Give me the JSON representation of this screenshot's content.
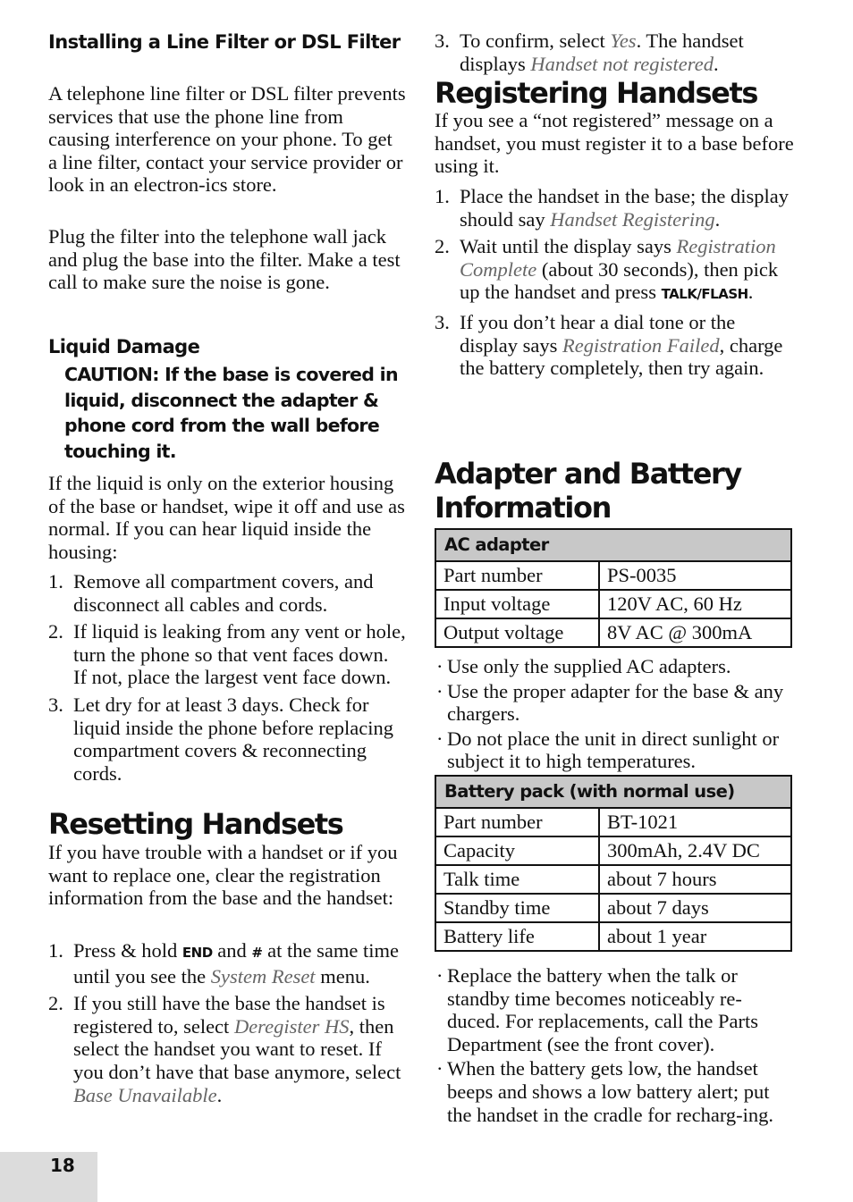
{
  "page_number": "18",
  "left": {
    "line_filter": {
      "heading": "Installing a Line Filter or DSL Filter",
      "para1": "A telephone line filter or DSL filter prevents services that use the phone line from causing interference on your phone. To get a line filter, contact your service provider or look in an electron-ics store.",
      "para2": "Plug the filter into the telephone wall jack and plug the base into the filter. Make a test call to make sure the noise is gone."
    },
    "liquid_damage": {
      "heading": "Liquid Damage",
      "caution": "CAUTION: If the base is covered in liquid, disconnect the adapter & phone cord from the wall before touching it.",
      "intro": "If the liquid is only on the exterior housing of the base or handset, wipe it off and use as normal. If you can hear liquid inside the housing:",
      "steps": [
        {
          "num": "1.",
          "text": "Remove all compartment covers, and disconnect all cables and cords."
        },
        {
          "num": "2.",
          "text": "If liquid is leaking from any vent or hole, turn the phone so that vent faces down. If not, place the largest vent face down."
        },
        {
          "num": "3.",
          "text": "Let dry for at least 3 days. Check for liquid inside the phone before replacing compartment covers & reconnecting cords."
        }
      ]
    },
    "resetting": {
      "heading": "Resetting Handsets",
      "intro": "If you have trouble with a handset or if you want to replace one, clear the registration information from the base and the handset:",
      "step1": {
        "num": "1.",
        "pre": "Press & hold ",
        "key1": "END",
        "mid": " and ",
        "key2": "#",
        "mid2": " at the same time until you see the ",
        "display": "System Reset",
        "post": " menu."
      },
      "step2": {
        "num": "2.",
        "pre": "If you still have the base the handset is registered to, select ",
        "display1": "Deregister HS",
        "mid": ", then select the handset you want to reset. If you don’t have that base anymore, select ",
        "display2": "Base Unavailable",
        "post": "."
      }
    }
  },
  "right": {
    "reset_step3": {
      "num": "3.",
      "pre": "To confirm, select ",
      "display1": "Yes",
      "mid": ". The handset displays ",
      "display2": "Handset not registered",
      "post": "."
    },
    "registering": {
      "heading": "Registering Handsets",
      "intro": "If you see a “not registered” message on a handset, you must register it to a base before using it.",
      "step1": {
        "num": "1.",
        "pre": "Place the handset in the base; the display should say ",
        "display": "Handset Registering",
        "post": "."
      },
      "step2": {
        "num": "2.",
        "pre": "Wait until the display says ",
        "display": "Registration Complete",
        "mid": " (about 30 seconds), then pick up the handset and press ",
        "key": "TALK/FLASH",
        "post": "."
      },
      "step3": {
        "num": "3.",
        "pre": "If you don’t hear a dial tone or the display says ",
        "display": "Registration Failed",
        "post": ", charge the battery completely, then try again."
      }
    },
    "adapter_battery": {
      "heading": "Adapter and Battery Information",
      "ac_table": {
        "title": "AC adapter",
        "rows": [
          {
            "key": "Part number",
            "value": "PS-0035"
          },
          {
            "key": "Input voltage",
            "value": "120V AC, 60 Hz"
          },
          {
            "key": "Output voltage",
            "value": "8V AC @ 300mA"
          }
        ]
      },
      "ac_bullets": [
        "Use only the supplied AC adapters.",
        "Use the proper adapter for the base & any chargers.",
        "Do not place the unit in direct sunlight or subject it to high temperatures."
      ],
      "battery_table": {
        "title": "Battery pack (with normal use)",
        "rows": [
          {
            "key": "Part number",
            "value": "BT-1021"
          },
          {
            "key": "Capacity",
            "value": "300mAh, 2.4V DC"
          },
          {
            "key": "Talk time",
            "value": "about 7 hours"
          },
          {
            "key": "Standby time",
            "value": "about 7 days"
          },
          {
            "key": "Battery life",
            "value": "about 1 year"
          }
        ]
      },
      "battery_bullets": [
        "Replace the battery when the talk or standby time becomes noticeably re-duced. For replacements, call the Parts Department (see the front cover).",
        "When the battery gets low, the handset beeps and shows a low battery alert; put the handset in the cradle for recharg-ing."
      ]
    }
  }
}
